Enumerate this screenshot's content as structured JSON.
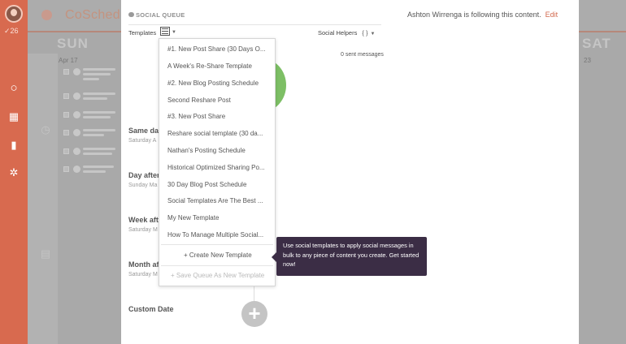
{
  "sidebar": {
    "count": "✓26"
  },
  "background": {
    "logo": "CoSchedule",
    "days": [
      "SUN",
      "SAT"
    ],
    "dates": [
      "Apr 17",
      "23"
    ]
  },
  "header": {
    "title": "SOCIAL QUEUE",
    "follow_text": "Ashton Wirrenga is following this content.",
    "edit": "Edit"
  },
  "toolbar": {
    "templates_label": "Templates",
    "social_helpers": "Social Helpers",
    "braces": "{ }",
    "sent_messages": "0 sent messages"
  },
  "sections": [
    {
      "heading": "Same day",
      "sub": "Saturday A"
    },
    {
      "heading": "Day after",
      "sub": "Sunday Ma"
    },
    {
      "heading": "Week aft",
      "sub": "Saturday M"
    },
    {
      "heading": "Month af",
      "sub": "Saturday M"
    },
    {
      "heading": "Custom Date",
      "sub": ""
    }
  ],
  "dropdown": {
    "items": [
      "#1. New Post Share (30 Days O...",
      "A Week's Re-Share Template",
      "#2. New Blog Posting Schedule",
      "Second Reshare Post",
      "#3. New Post Share",
      "Reshare social template (30 da...",
      "Nathan's Posting Schedule",
      "Historical Optimized Sharing Po...",
      "30 Day Blog Post Schedule",
      "Social Templates Are The Best ...",
      "My New Template",
      "How To Manage Multiple Social..."
    ],
    "create": "+ Create New Template",
    "save": "+ Save Queue As New Template"
  },
  "tooltip": {
    "text": "Use social templates to apply social messages in bulk to any piece of content you create. Get started now!"
  },
  "add_button": "+"
}
